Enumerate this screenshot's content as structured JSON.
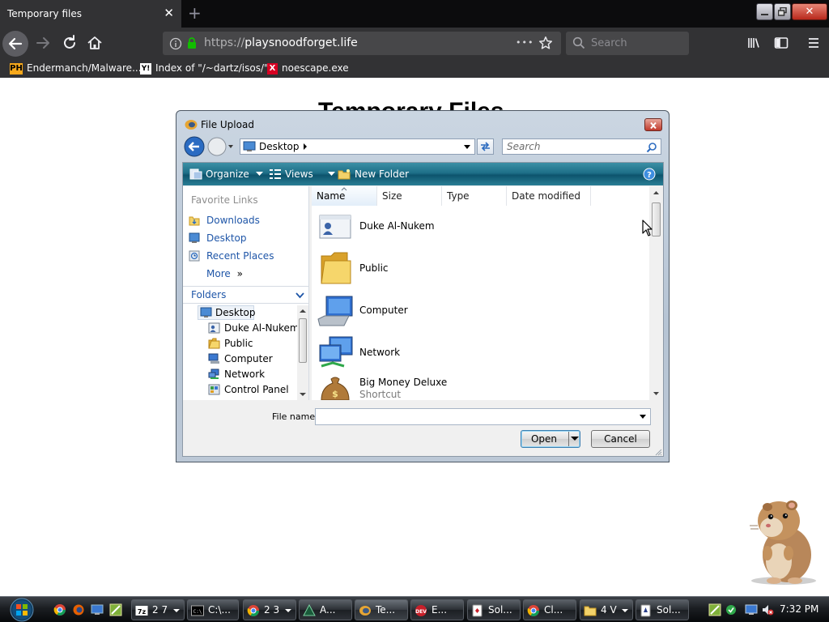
{
  "browser": {
    "tab_title": "Temporary files",
    "tab_close_glyph": "✕",
    "new_tab_glyph": "+",
    "url_scheme": "https://",
    "url_host": "playsnoodforget.life",
    "page_actions_glyph": "•••",
    "search_placeholder": "Search",
    "bookmarks": [
      {
        "label": "Endermanch/Malware...",
        "icon": "PH",
        "icon_bg": "#f7a81b",
        "icon_color": "#000000"
      },
      {
        "label": "Index of \"/~dartz/isos/\"",
        "icon": "Y!",
        "icon_bg": "#ffffff",
        "icon_color": "#000000"
      },
      {
        "label": "noescape.exe",
        "icon": "X",
        "icon_bg": "#d70022",
        "icon_color": "#ffffff"
      }
    ]
  },
  "page": {
    "title": "Temporary Files"
  },
  "dialog": {
    "title": "File Upload",
    "address": "Desktop",
    "search_placeholder": "Search",
    "toolbar": {
      "organize": "Organize",
      "views": "Views",
      "new_folder": "New Folder"
    },
    "favorite_links_header": "Favorite Links",
    "favorite_links": [
      "Downloads",
      "Desktop",
      "Recent Places"
    ],
    "more_label": "More",
    "more_glyph": "»",
    "folders_header": "Folders",
    "tree": [
      "Desktop",
      "Duke Al-Nukem",
      "Public",
      "Computer",
      "Network",
      "Control Panel"
    ],
    "columns": [
      "Name",
      "Size",
      "Type",
      "Date modified"
    ],
    "files": [
      {
        "name": "Duke Al-Nukem",
        "sub": "",
        "icon": "user-folder-icon"
      },
      {
        "name": "Public",
        "sub": "",
        "icon": "folder-icon"
      },
      {
        "name": "Computer",
        "sub": "",
        "icon": "computer-icon"
      },
      {
        "name": "Network",
        "sub": "",
        "icon": "network-icon"
      },
      {
        "name": "Big Money Deluxe",
        "sub": "Shortcut",
        "icon": "money-bag-icon"
      }
    ],
    "file_name_label": "File name:",
    "file_name_value": "",
    "open_label": "Open",
    "cancel_label": "Cancel"
  },
  "taskbar": {
    "buttons": [
      {
        "label": "2 7",
        "icon": "7z-icon",
        "dropdown": true
      },
      {
        "label": "C:\\...",
        "icon": "cmd-icon",
        "dropdown": false
      },
      {
        "label": "2 3",
        "icon": "chrome-icon",
        "dropdown": true
      },
      {
        "label": "A...",
        "icon": "app-icon",
        "dropdown": false
      },
      {
        "label": "Te...",
        "icon": "firefox-icon",
        "dropdown": false,
        "active": true
      },
      {
        "label": "E...",
        "icon": "dev-icon",
        "dropdown": false
      },
      {
        "label": "Sol...",
        "icon": "solitaire-icon",
        "dropdown": false
      },
      {
        "label": "Cl...",
        "icon": "chrome-icon",
        "dropdown": false
      },
      {
        "label": "4 V",
        "icon": "folder-icon",
        "dropdown": true
      },
      {
        "label": "Sol...",
        "icon": "solitaire-icon",
        "dropdown": false
      }
    ],
    "clock": "7:32 PM"
  },
  "colors": {
    "firefox_dark": "#323234",
    "vista_toolbar": "#1e6f88",
    "link_blue": "#1f56a8",
    "secure_green": "#12bc00"
  }
}
